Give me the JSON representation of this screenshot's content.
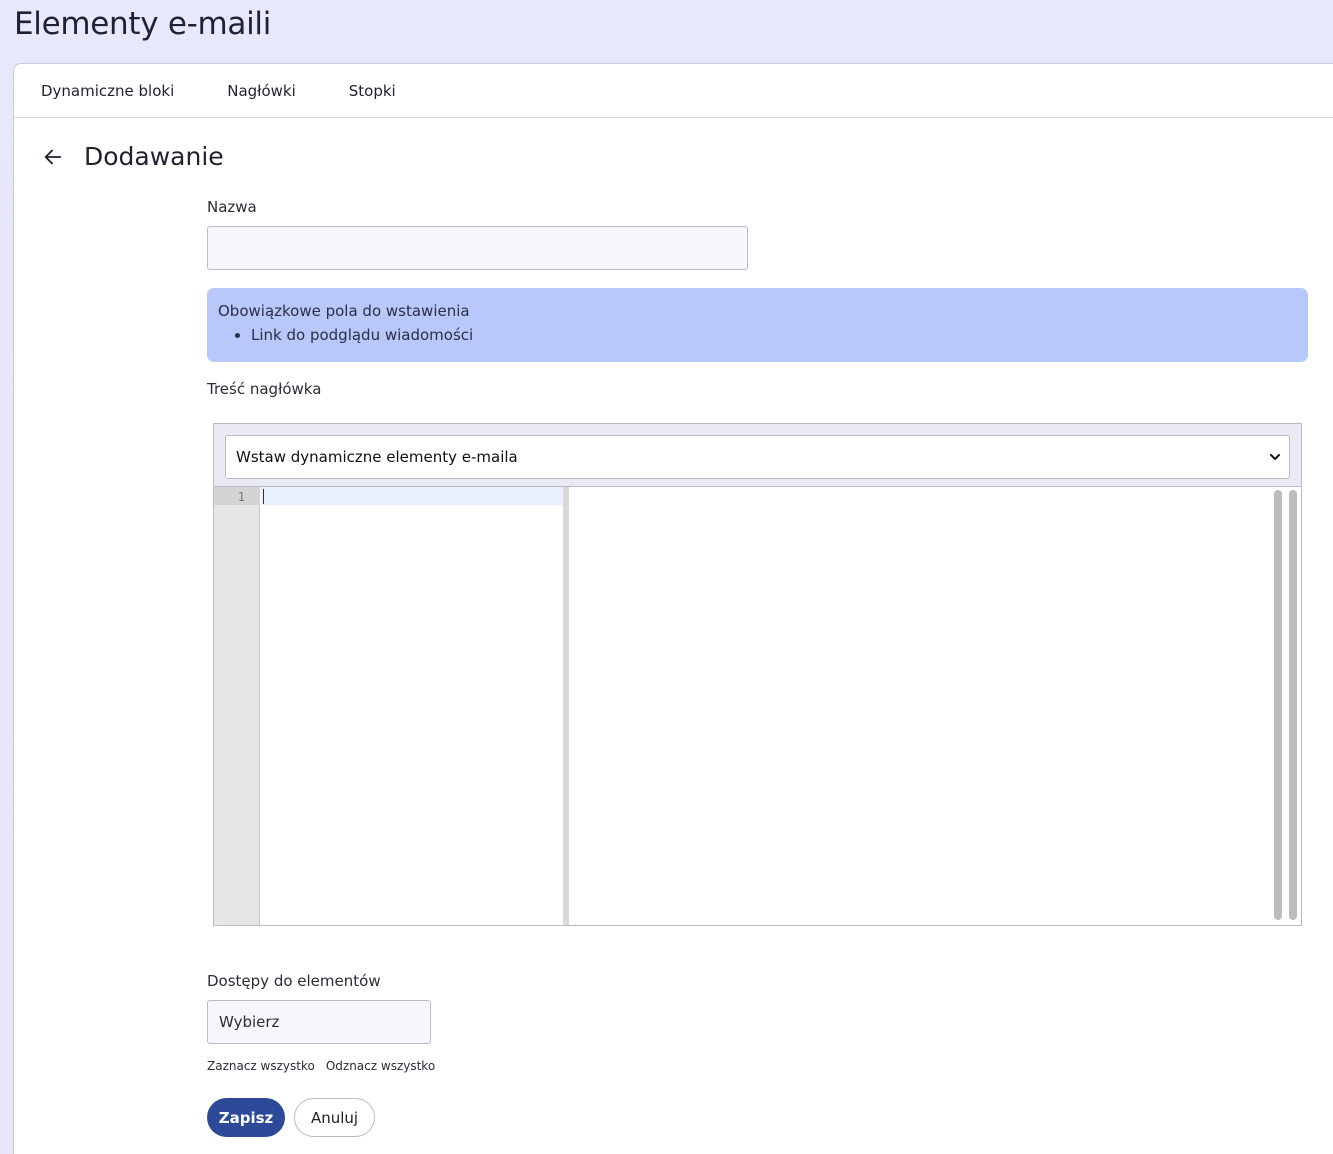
{
  "page": {
    "title": "Elementy e-maili"
  },
  "tabs": [
    {
      "label": "Dynamiczne bloki"
    },
    {
      "label": "Nagłówki"
    },
    {
      "label": "Stopki"
    }
  ],
  "form": {
    "heading": "Dodawanie",
    "name_label": "Nazwa",
    "name_value": "",
    "alert": {
      "title": "Obowiązkowe pola do wstawienia",
      "items": [
        "Link do podglądu wiadomości"
      ]
    },
    "content_label": "Treść nagłówka",
    "editor": {
      "select_label": "Wstaw dynamiczne elementy e-maila",
      "line_number": "1"
    },
    "access_label": "Dostępy do elementów",
    "access_value": "Wybierz",
    "select_all": "Zaznacz wszystko",
    "deselect_all": "Odznacz wszystko",
    "save_label": "Zapisz",
    "cancel_label": "Anuluj"
  },
  "colors": {
    "primary": "#2d4a9a",
    "alert_bg": "#b8c8fb"
  }
}
